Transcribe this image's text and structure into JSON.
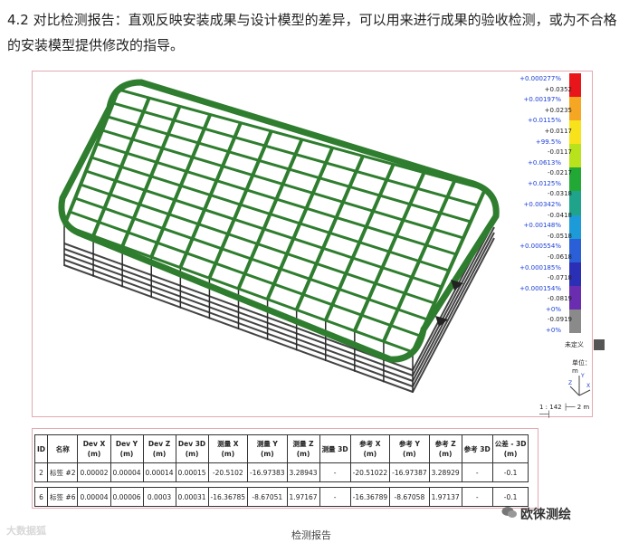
{
  "intro_text": "4.2 对比检测报告：直观反映安装成果与设计模型的差异，可以用来进行成果的验收检测，或为不合格的安装模型提供修改的指导。",
  "legend": {
    "labels": [
      {
        "text": "+0.000277%",
        "kind": "pct"
      },
      {
        "text": "+0.0352",
        "kind": "val"
      },
      {
        "text": "+0.00197%",
        "kind": "pct"
      },
      {
        "text": "+0.0235",
        "kind": "val"
      },
      {
        "text": "+0.0115%",
        "kind": "pct"
      },
      {
        "text": "+0.0117",
        "kind": "val"
      },
      {
        "text": "+99.5%",
        "kind": "pct"
      },
      {
        "text": "-0.0117",
        "kind": "val"
      },
      {
        "text": "+0.0613%",
        "kind": "pct"
      },
      {
        "text": "-0.0217",
        "kind": "val"
      },
      {
        "text": "+0.0125%",
        "kind": "pct"
      },
      {
        "text": "-0.0318",
        "kind": "val"
      },
      {
        "text": "+0.00342%",
        "kind": "pct"
      },
      {
        "text": "-0.0418",
        "kind": "val"
      },
      {
        "text": "+0.00148%",
        "kind": "pct"
      },
      {
        "text": "-0.0518",
        "kind": "val"
      },
      {
        "text": "+0.000554%",
        "kind": "pct"
      },
      {
        "text": "-0.0618",
        "kind": "val"
      },
      {
        "text": "+0.000185%",
        "kind": "pct"
      },
      {
        "text": "-0.0718",
        "kind": "val"
      },
      {
        "text": "+0.000154%",
        "kind": "pct"
      },
      {
        "text": "-0.0819",
        "kind": "val"
      },
      {
        "text": "+0%",
        "kind": "pct"
      },
      {
        "text": "-0.0919",
        "kind": "val"
      },
      {
        "text": "+0%",
        "kind": "pct"
      }
    ],
    "colors": [
      "#e8161b",
      "#f5a623",
      "#f7e21c",
      "#b7e21c",
      "#22a834",
      "#1fa38a",
      "#1c9bd8",
      "#2a5fd8",
      "#2b2fb5",
      "#6a2db0",
      "#8a8a8a"
    ],
    "undefined_label": "未定义",
    "unit_label": "单位：  m",
    "scale_label": "1 : 142   ├── 2 m ──┤"
  },
  "table": {
    "headers": [
      [
        "ID",
        ""
      ],
      [
        "名称",
        ""
      ],
      [
        "Dev X",
        "(m)"
      ],
      [
        "Dev Y",
        "(m)"
      ],
      [
        "Dev Z",
        "(m)"
      ],
      [
        "Dev 3D",
        "(m)"
      ],
      [
        "测量 X",
        "(m)"
      ],
      [
        "测量 Y",
        "(m)"
      ],
      [
        "测量 Z",
        "(m)"
      ],
      [
        "测量 3D",
        ""
      ],
      [
        "参考 X",
        "(m)"
      ],
      [
        "参考 Y",
        "(m)"
      ],
      [
        "参考 Z",
        "(m)"
      ],
      [
        "参考 3D",
        ""
      ],
      [
        "公差 - 3D",
        "(m)"
      ]
    ],
    "rows": [
      [
        "2",
        "标签 #2",
        "0.00002",
        "0.00004",
        "0.00014",
        "0.00015",
        "-20.5102",
        "-16.97383",
        "3.28943",
        "-",
        "-20.51022",
        "-16.97387",
        "3.28929",
        "-",
        "-0.1"
      ],
      [
        "6",
        "标签 #6",
        "0.00004",
        "0.00006",
        "0.0003",
        "0.00031",
        "-16.36785",
        "-8.67051",
        "1.97167",
        "-",
        "-16.36789",
        "-8.67058",
        "1.97137",
        "-",
        "-0.1"
      ]
    ]
  },
  "caption": "检测报告",
  "watermark_left": "大数据狐",
  "watermark_right": "欧徕测绘"
}
